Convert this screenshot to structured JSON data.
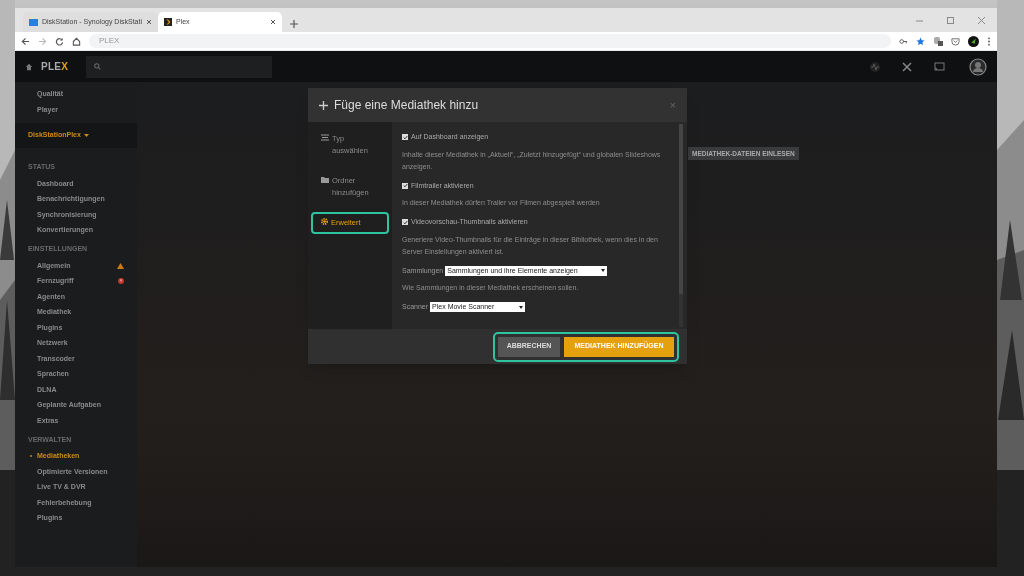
{
  "browser": {
    "tabs": [
      {
        "title": "DiskStation - Synology DiskStati",
        "selected": false
      },
      {
        "title": "Plex",
        "selected": true
      }
    ],
    "address": "PLEX"
  },
  "plex": {
    "logo": "PLEX",
    "sidebar": {
      "top_items": [
        "Qualität",
        "Player"
      ],
      "server": "DiskStationPlex",
      "sections": [
        {
          "heading": "STATUS",
          "items": [
            {
              "label": "Dashboard",
              "selected": false
            },
            {
              "label": "Benachrichtigungen",
              "selected": false
            },
            {
              "label": "Synchronisierung",
              "selected": false
            },
            {
              "label": "Konvertierungen",
              "selected": false
            }
          ]
        },
        {
          "heading": "EINSTELLUNGEN",
          "items": [
            {
              "label": "Allgemein",
              "selected": false,
              "warning": true
            },
            {
              "label": "Fernzugriff",
              "selected": false,
              "error": true
            },
            {
              "label": "Agenten",
              "selected": false
            },
            {
              "label": "Mediathek",
              "selected": false
            },
            {
              "label": "Plugins",
              "selected": false
            },
            {
              "label": "Netzwerk",
              "selected": false
            },
            {
              "label": "Transcoder",
              "selected": false
            },
            {
              "label": "Sprachen",
              "selected": false
            },
            {
              "label": "DLNA",
              "selected": false
            },
            {
              "label": "Geplante Aufgaben",
              "selected": false
            },
            {
              "label": "Extras",
              "selected": false
            }
          ]
        },
        {
          "heading": "VERWALTEN",
          "items": [
            {
              "label": "Mediatheken",
              "selected": true
            },
            {
              "label": "Optimierte Versionen",
              "selected": false
            },
            {
              "label": "Live TV & DVR",
              "selected": false
            },
            {
              "label": "Fehlerbehebung",
              "selected": false
            },
            {
              "label": "Plugins",
              "selected": false
            }
          ]
        }
      ]
    },
    "page_button": "MEDIATHEK-DATEIEN EINLESEN",
    "modal": {
      "title": "Füge eine Mediathek hinzu",
      "close": "×",
      "nav": [
        {
          "label": "Typ auswählen",
          "selected": false,
          "highlighted": false
        },
        {
          "label": "Ordner hinzufügen",
          "selected": false,
          "highlighted": false
        },
        {
          "label": "Erweitert",
          "selected": true,
          "highlighted": true
        }
      ],
      "options": [
        {
          "kind": "checkbox",
          "label": "Auf Dashboard anzeigen",
          "checked": true,
          "description": "Inhalte dieser Mediathek in „Aktuell“, „Zuletzt hinzugefügt“ und globalen Slideshows anzeigen."
        },
        {
          "kind": "checkbox",
          "label": "Filmtrailer aktivieren",
          "checked": true,
          "description": "In dieser Mediathek dürfen Trailer vor Filmen abgespielt werden"
        },
        {
          "kind": "checkbox",
          "label": "Videovorschau-Thumbnails aktivieren",
          "checked": true,
          "description": "Generiere Video-Thumbnails für die Einträge in dieser Bibliothek, wenn dies in den Server Einstellungen aktiviert ist."
        },
        {
          "kind": "select",
          "label": "Sammlungen",
          "value": "Sammlungen und ihre Elemente anzeigen",
          "description": "Wie Sammlungen in dieser Mediathek erscheinen sollen."
        },
        {
          "kind": "select",
          "label": "Scanner",
          "value": "Plex Movie Scanner"
        }
      ],
      "footer": {
        "highlighted": true,
        "buttons": [
          {
            "label": "ABBRECHEN",
            "kind": "secondary"
          },
          {
            "label": "MEDIATHEK HINZUFÜGEN",
            "kind": "primary"
          }
        ]
      }
    }
  }
}
